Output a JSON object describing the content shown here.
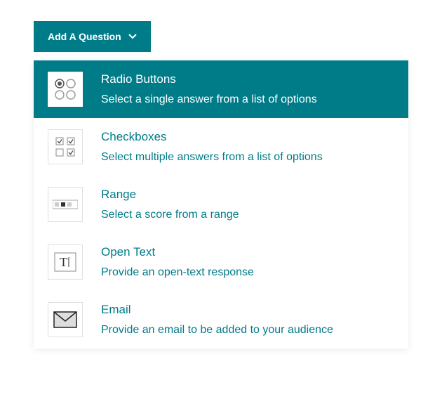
{
  "button": {
    "label": "Add A Question"
  },
  "options": [
    {
      "icon": "radio",
      "title": "Radio Buttons",
      "desc": "Select a single answer from a list of options",
      "selected": true
    },
    {
      "icon": "checkbox",
      "title": "Checkboxes",
      "desc": "Select multiple answers from a list of options",
      "selected": false
    },
    {
      "icon": "range",
      "title": "Range",
      "desc": "Select a score from a range",
      "selected": false
    },
    {
      "icon": "opentext",
      "title": "Open Text",
      "desc": "Provide an open-text response",
      "selected": false
    },
    {
      "icon": "email",
      "title": "Email",
      "desc": "Provide an email to be added to your audience",
      "selected": false
    }
  ]
}
